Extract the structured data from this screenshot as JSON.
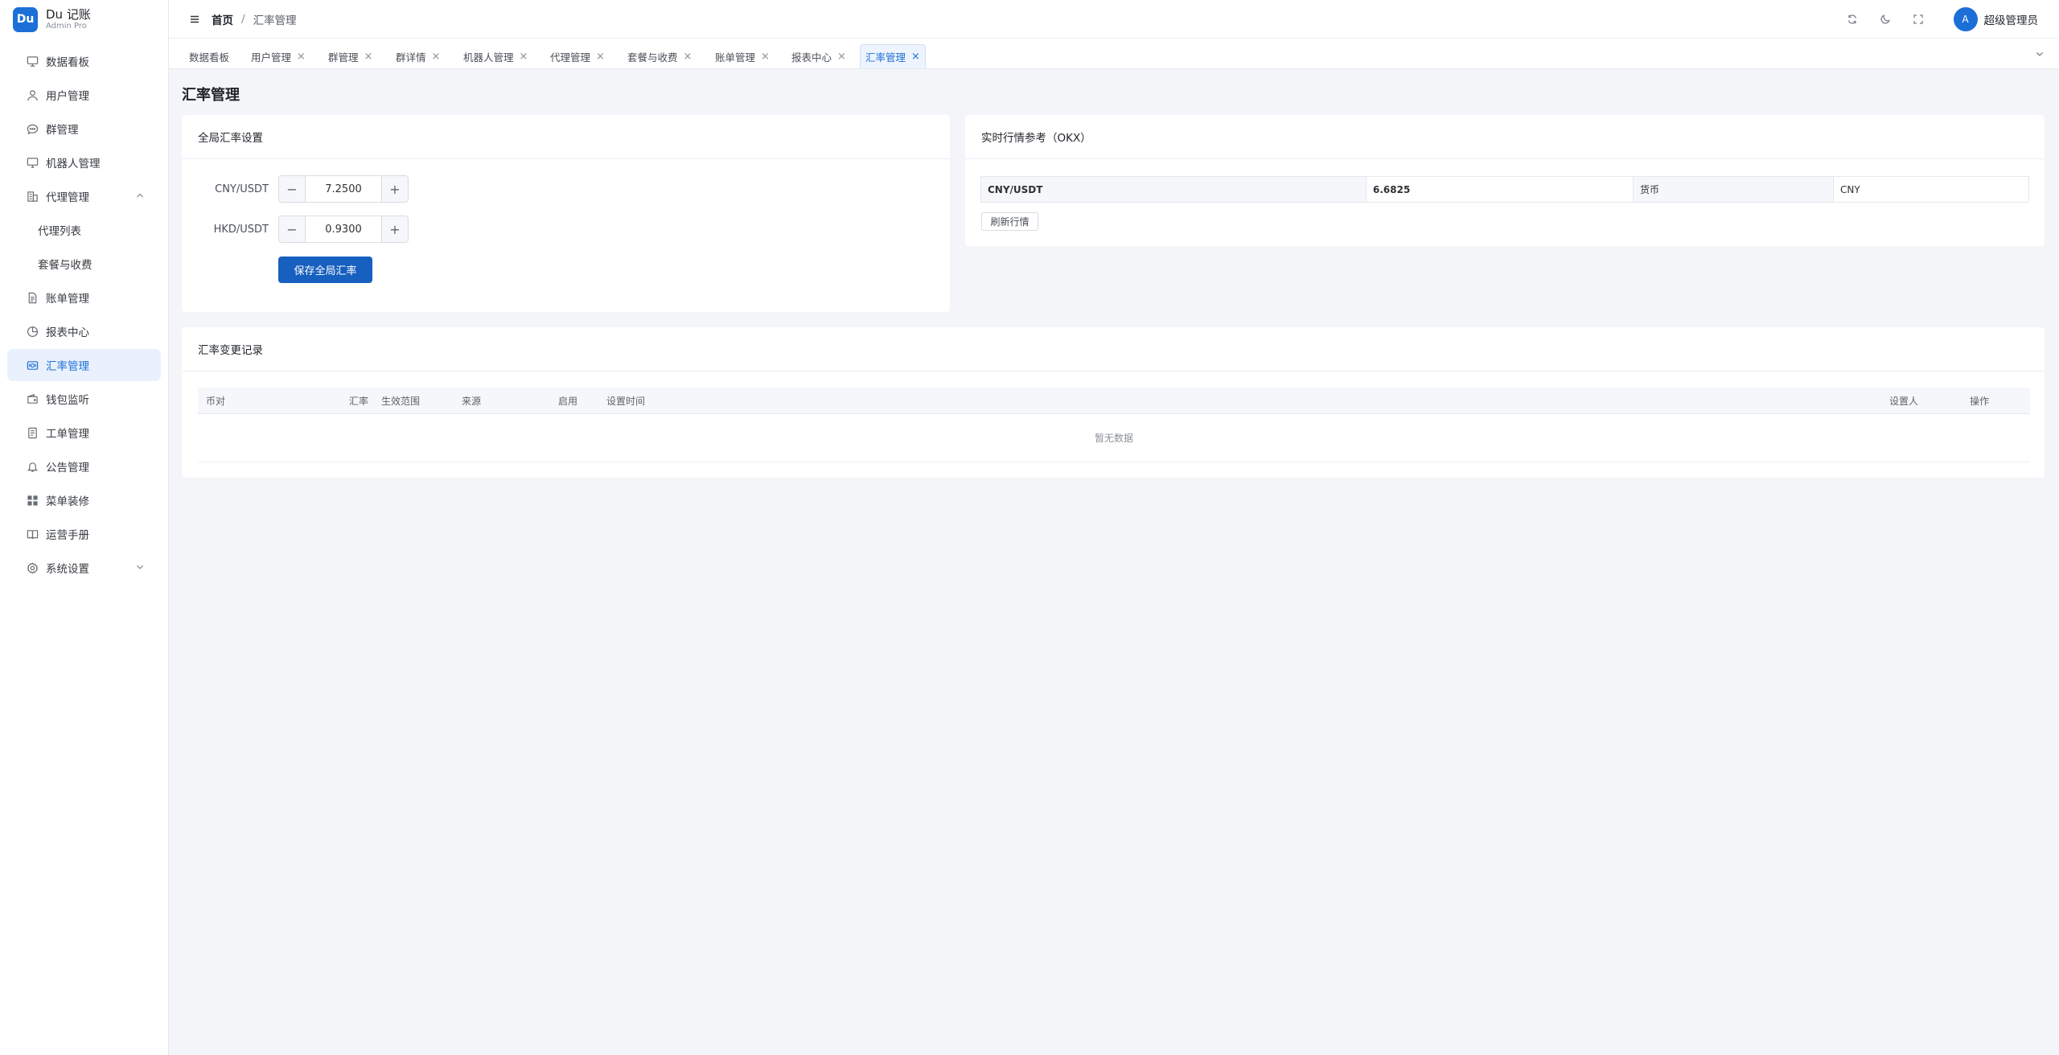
{
  "app": {
    "logo_badge": "Du",
    "title": "Du 记账",
    "subtitle": "Admin Pro"
  },
  "sidebar": {
    "items": [
      {
        "label": "数据看板",
        "icon": "dashboard-icon"
      },
      {
        "label": "用户管理",
        "icon": "user-icon"
      },
      {
        "label": "群管理",
        "icon": "chat-icon"
      },
      {
        "label": "机器人管理",
        "icon": "monitor-icon"
      },
      {
        "label": "代理管理",
        "icon": "building-icon",
        "expanded": true
      },
      {
        "label": "代理列表",
        "sub": true
      },
      {
        "label": "套餐与收费",
        "sub": true
      },
      {
        "label": "账单管理",
        "icon": "document-icon"
      },
      {
        "label": "报表中心",
        "icon": "pie-chart-icon"
      },
      {
        "label": "汇率管理",
        "icon": "exchange-icon",
        "active": true
      },
      {
        "label": "钱包监听",
        "icon": "wallet-icon"
      },
      {
        "label": "工单管理",
        "icon": "ticket-icon"
      },
      {
        "label": "公告管理",
        "icon": "bell-icon"
      },
      {
        "label": "菜单装修",
        "icon": "grid-icon"
      },
      {
        "label": "运营手册",
        "icon": "book-icon"
      },
      {
        "label": "系统设置",
        "icon": "gear-icon",
        "collapsed": true
      }
    ]
  },
  "header": {
    "breadcrumb_home": "首页",
    "breadcrumb_sep": "/",
    "breadcrumb_current": "汇率管理",
    "user_initial": "A",
    "user_name": "超级管理员"
  },
  "tabs": [
    {
      "label": "数据看板",
      "closable": false
    },
    {
      "label": "用户管理",
      "closable": true
    },
    {
      "label": "群管理",
      "closable": true
    },
    {
      "label": "群详情",
      "closable": true
    },
    {
      "label": "机器人管理",
      "closable": true
    },
    {
      "label": "代理管理",
      "closable": true
    },
    {
      "label": "套餐与收费",
      "closable": true
    },
    {
      "label": "账单管理",
      "closable": true
    },
    {
      "label": "报表中心",
      "closable": true
    },
    {
      "label": "汇率管理",
      "closable": true,
      "active": true
    }
  ],
  "page": {
    "title": "汇率管理"
  },
  "global_rate": {
    "card_title": "全局汇率设置",
    "rows": [
      {
        "label": "CNY/USDT",
        "value": "7.2500"
      },
      {
        "label": "HKD/USDT",
        "value": "0.9300"
      }
    ],
    "save_label": "保存全局汇率",
    "minus": "−",
    "plus": "+"
  },
  "realtime": {
    "card_title": "实时行情参考（OKX）",
    "pair_label": "CNY/USDT",
    "pair_value": "6.6825",
    "currency_label": "货币",
    "currency_value": "CNY",
    "refresh_label": "刷新行情"
  },
  "history": {
    "card_title": "汇率变更记录",
    "columns": [
      "币对",
      "汇率",
      "生效范围",
      "来源",
      "启用",
      "设置时间",
      "设置人",
      "操作"
    ],
    "empty_text": "暂无数据"
  },
  "colors": {
    "primary": "#1d6fd8",
    "button": "#1760bf",
    "active_bg": "#e9f1fc"
  }
}
